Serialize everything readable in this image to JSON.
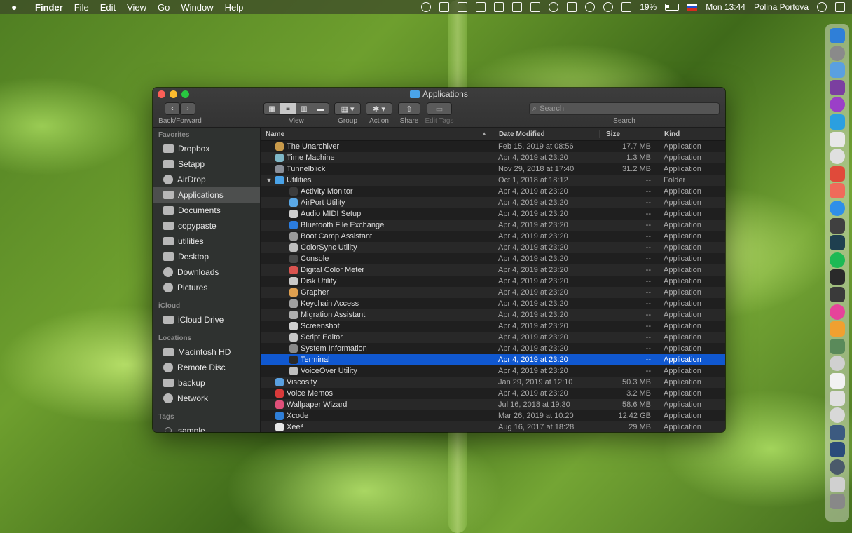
{
  "menubar": {
    "apple": "",
    "items": [
      "Finder",
      "File",
      "Edit",
      "View",
      "Go",
      "Window",
      "Help"
    ],
    "battery": "19%",
    "clock": "Mon 13:44",
    "user": "Polina Portova"
  },
  "window": {
    "title": "Applications",
    "toolbar": {
      "back_forward": "Back/Forward",
      "view": "View",
      "group": "Group",
      "action": "Action",
      "share": "Share",
      "edit_tags": "Edit Tags",
      "search_label": "Search",
      "search_placeholder": "Search"
    }
  },
  "sidebar": {
    "favorites_header": "Favorites",
    "favorites": [
      {
        "label": "Dropbox",
        "icon": "folder-icon"
      },
      {
        "label": "Setapp",
        "icon": "folder-icon"
      },
      {
        "label": "AirDrop",
        "icon": "airdrop-icon"
      },
      {
        "label": "Applications",
        "icon": "applications-icon",
        "selected": true
      },
      {
        "label": "Documents",
        "icon": "documents-icon"
      },
      {
        "label": "copypaste",
        "icon": "folder-icon"
      },
      {
        "label": "utilities",
        "icon": "folder-icon"
      },
      {
        "label": "Desktop",
        "icon": "desktop-icon"
      },
      {
        "label": "Downloads",
        "icon": "downloads-icon"
      },
      {
        "label": "Pictures",
        "icon": "pictures-icon"
      }
    ],
    "icloud_header": "iCloud",
    "icloud": [
      {
        "label": "iCloud Drive",
        "icon": "cloud-icon"
      }
    ],
    "locations_header": "Locations",
    "locations": [
      {
        "label": "Macintosh HD",
        "icon": "disk-icon"
      },
      {
        "label": "Remote Disc",
        "icon": "disc-icon"
      },
      {
        "label": "backup",
        "icon": "disk-icon"
      },
      {
        "label": "Network",
        "icon": "network-icon"
      }
    ],
    "tags_header": "Tags",
    "tags": [
      {
        "label": "sample"
      }
    ]
  },
  "list": {
    "columns": {
      "name": "Name",
      "date": "Date Modified",
      "size": "Size",
      "kind": "Kind"
    },
    "rows": [
      {
        "name": "The Unarchiver",
        "date": "Feb 15, 2019 at 08:56",
        "size": "17.7 MB",
        "kind": "Application",
        "indent": 0,
        "color": "#c89a4a"
      },
      {
        "name": "Time Machine",
        "date": "Apr 4, 2019 at 23:20",
        "size": "1.3 MB",
        "kind": "Application",
        "indent": 0,
        "color": "#7fb8c8"
      },
      {
        "name": "Tunnelblick",
        "date": "Nov 29, 2018 at 17:40",
        "size": "31.2 MB",
        "kind": "Application",
        "indent": 0,
        "color": "#8a8f99"
      },
      {
        "name": "Utilities",
        "date": "Oct 1, 2018 at 18:12",
        "size": "--",
        "kind": "Folder",
        "indent": 0,
        "color": "#4aa3e8",
        "folder": true,
        "disclosure": "▼"
      },
      {
        "name": "Activity Monitor",
        "date": "Apr 4, 2019 at 23:20",
        "size": "--",
        "kind": "Application",
        "indent": 1,
        "color": "#3c3c3c"
      },
      {
        "name": "AirPort Utility",
        "date": "Apr 4, 2019 at 23:20",
        "size": "--",
        "kind": "Application",
        "indent": 1,
        "color": "#5aa8e6"
      },
      {
        "name": "Audio MIDI Setup",
        "date": "Apr 4, 2019 at 23:20",
        "size": "--",
        "kind": "Application",
        "indent": 1,
        "color": "#d0d0d0"
      },
      {
        "name": "Bluetooth File Exchange",
        "date": "Apr 4, 2019 at 23:20",
        "size": "--",
        "kind": "Application",
        "indent": 1,
        "color": "#2b7de0"
      },
      {
        "name": "Boot Camp Assistant",
        "date": "Apr 4, 2019 at 23:20",
        "size": "--",
        "kind": "Application",
        "indent": 1,
        "color": "#9a9a9a"
      },
      {
        "name": "ColorSync Utility",
        "date": "Apr 4, 2019 at 23:20",
        "size": "--",
        "kind": "Application",
        "indent": 1,
        "color": "#bdbdbd"
      },
      {
        "name": "Console",
        "date": "Apr 4, 2019 at 23:20",
        "size": "--",
        "kind": "Application",
        "indent": 1,
        "color": "#4a4a4a"
      },
      {
        "name": "Digital Color Meter",
        "date": "Apr 4, 2019 at 23:20",
        "size": "--",
        "kind": "Application",
        "indent": 1,
        "color": "#d9534f"
      },
      {
        "name": "Disk Utility",
        "date": "Apr 4, 2019 at 23:20",
        "size": "--",
        "kind": "Application",
        "indent": 1,
        "color": "#c9c9c9"
      },
      {
        "name": "Grapher",
        "date": "Apr 4, 2019 at 23:20",
        "size": "--",
        "kind": "Application",
        "indent": 1,
        "color": "#e0a050"
      },
      {
        "name": "Keychain Access",
        "date": "Apr 4, 2019 at 23:20",
        "size": "--",
        "kind": "Application",
        "indent": 1,
        "color": "#a0a0a0"
      },
      {
        "name": "Migration Assistant",
        "date": "Apr 4, 2019 at 23:20",
        "size": "--",
        "kind": "Application",
        "indent": 1,
        "color": "#b0b0b0"
      },
      {
        "name": "Screenshot",
        "date": "Apr 4, 2019 at 23:20",
        "size": "--",
        "kind": "Application",
        "indent": 1,
        "color": "#d0d0d0"
      },
      {
        "name": "Script Editor",
        "date": "Apr 4, 2019 at 23:20",
        "size": "--",
        "kind": "Application",
        "indent": 1,
        "color": "#c8c8c8"
      },
      {
        "name": "System Information",
        "date": "Apr 4, 2019 at 23:20",
        "size": "--",
        "kind": "Application",
        "indent": 1,
        "color": "#8a8a8a"
      },
      {
        "name": "Terminal",
        "date": "Apr 4, 2019 at 23:20",
        "size": "--",
        "kind": "Application",
        "indent": 1,
        "color": "#2a2a2a",
        "selected": true
      },
      {
        "name": "VoiceOver Utility",
        "date": "Apr 4, 2019 at 23:20",
        "size": "--",
        "kind": "Application",
        "indent": 1,
        "color": "#c0c0c0"
      },
      {
        "name": "Viscosity",
        "date": "Jan 29, 2019 at 12:10",
        "size": "50.3 MB",
        "kind": "Application",
        "indent": 0,
        "color": "#5aa0e0"
      },
      {
        "name": "Voice Memos",
        "date": "Apr 4, 2019 at 23:20",
        "size": "3.2 MB",
        "kind": "Application",
        "indent": 0,
        "color": "#d83a3a"
      },
      {
        "name": "Wallpaper Wizard",
        "date": "Jul 16, 2018 at 19:30",
        "size": "58.6 MB",
        "kind": "Application",
        "indent": 0,
        "color": "#e0507a"
      },
      {
        "name": "Xcode",
        "date": "Mar 26, 2019 at 10:20",
        "size": "12.42 GB",
        "kind": "Application",
        "indent": 0,
        "color": "#2f7fd8"
      },
      {
        "name": "Xee³",
        "date": "Aug 16, 2017 at 18:28",
        "size": "29 MB",
        "kind": "Application",
        "indent": 0,
        "color": "#e8e8e8"
      }
    ]
  },
  "dock": {
    "colors": [
      "#2f7fd8",
      "#8a8a8a",
      "#5aa0e0",
      "#7b3fa0",
      "#9b3fc8",
      "#2b9fe0",
      "#e8e8e8",
      "#e0e0e0",
      "#e04a3a",
      "#f06a5a",
      "#2f8fe8",
      "#404040",
      "#1e3f4f",
      "#1db954",
      "#2a2a2a",
      "#3a3a3a",
      "#e6449a",
      "#f0a030",
      "#5a8a5a",
      "#d0d0d0",
      "#f2f2f2",
      "#e0e0e0",
      "#d8d8d8",
      "#3c5a80",
      "#2a4a7a",
      "#4a5a6a",
      "#d0d0d0",
      "#888888"
    ]
  }
}
